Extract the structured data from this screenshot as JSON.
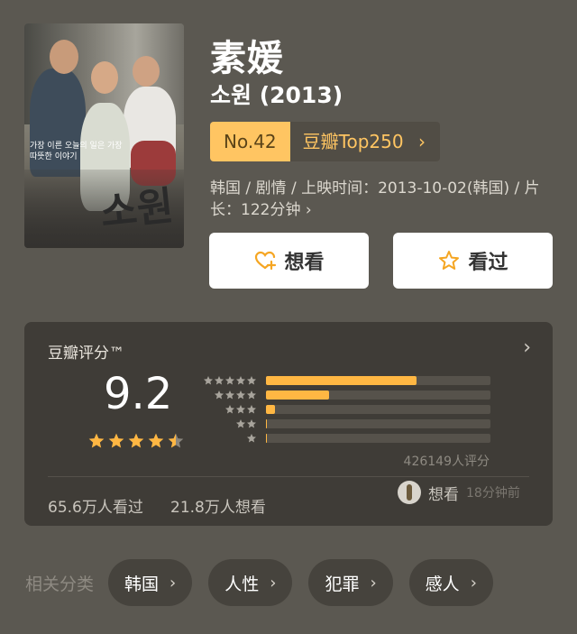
{
  "movie": {
    "title": "素媛",
    "original_title": "소원 (2013)",
    "poster": {
      "title_text": "소원",
      "tagline": "가장 이른 오늘의 일은 가장 따뜻한 이야기"
    },
    "rank_number": "No.42",
    "rank_list": "豆瓣Top250",
    "rank_chevron": "›",
    "meta": "韩国 / 剧情 / 上映时间：2013-10-02(韩国) / 片长：122分钟 ›"
  },
  "actions": {
    "want_label": "想看",
    "seen_label": "看过"
  },
  "rating": {
    "label": "豆瓣评分™",
    "chevron": "›",
    "score": "9.2",
    "stars_filled": 4.5,
    "distribution": [
      {
        "stars": 5,
        "fraction": 0.67
      },
      {
        "stars": 4,
        "fraction": 0.28
      },
      {
        "stars": 3,
        "fraction": 0.04
      },
      {
        "stars": 2,
        "fraction": 0.005
      },
      {
        "stars": 1,
        "fraction": 0.003
      }
    ],
    "count": "426149人评分",
    "watched": "65.6万人看过",
    "wanted": "21.8万人想看",
    "activity_verb": "想看",
    "activity_time": "18分钟前"
  },
  "tags": {
    "label": "相关分类",
    "items": [
      "韩国",
      "人性",
      "犯罪",
      "感人"
    ],
    "chevron": "›"
  },
  "colors": {
    "background": "#5b5851",
    "card": "#3f3c37",
    "accent": "#ffb743",
    "rank_badge": "#ffc562"
  }
}
